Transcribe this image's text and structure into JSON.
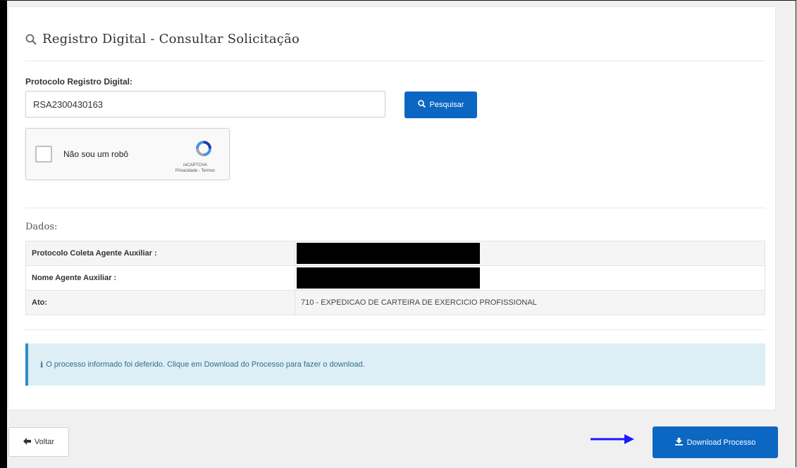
{
  "page": {
    "title": "Registro Digital - Consultar Solicitação",
    "title_icon": "search-icon"
  },
  "search": {
    "label": "Protocolo Registro Digital:",
    "value": "RSA2300430163",
    "button_label": "Pesquisar",
    "button_icon": "search-icon"
  },
  "captcha": {
    "checkbox_label": "Não sou um robô",
    "brand": "reCAPTCHA",
    "links": "Privacidade - Termos"
  },
  "dados": {
    "section_label": "Dados:",
    "rows": [
      {
        "label": "Protocolo Coleta Agente Auxiliar :",
        "value": "",
        "redacted": true
      },
      {
        "label": "Nome Agente Auxiliar :",
        "value": "",
        "redacted": true
      },
      {
        "label": "Ato:",
        "value": "710 - EXPEDICAO DE CARTEIRA DE EXERCICIO PROFISSIONAL",
        "redacted": false
      }
    ]
  },
  "alert": {
    "icon": "info-icon",
    "text": "O processo informado foi deferido. Clique em Download do Processo para fazer o download."
  },
  "footer": {
    "back_label": "Voltar",
    "back_icon": "arrow-left-icon",
    "download_label": "Download Processo",
    "download_icon": "download-icon"
  },
  "colors": {
    "primary": "#0b67c2",
    "alert_bg": "#ddeef5",
    "alert_border": "#2a8fc1",
    "annotation_arrow": "#1a1aff"
  }
}
